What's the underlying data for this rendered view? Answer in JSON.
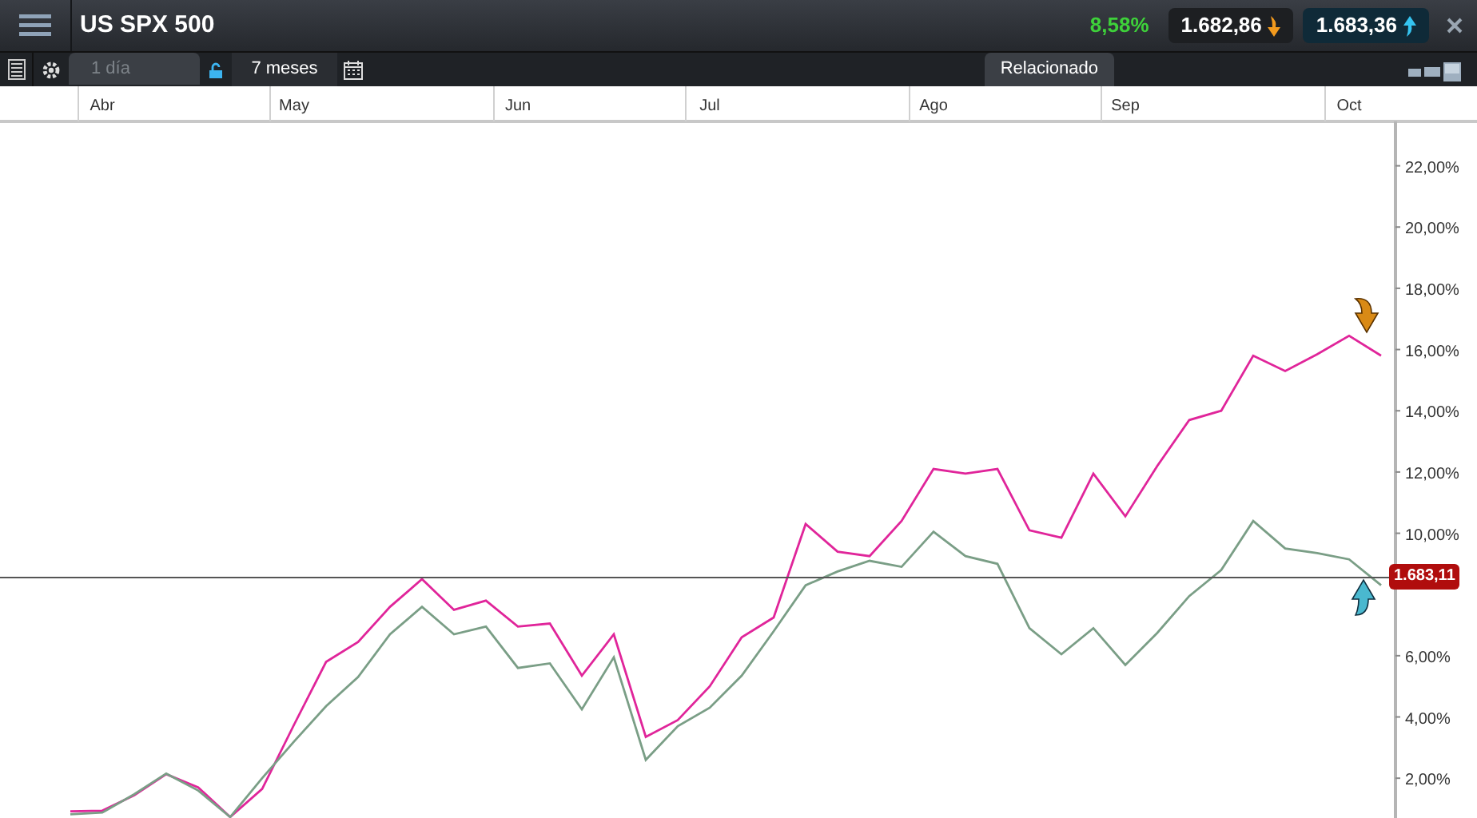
{
  "header": {
    "title": "US SPX 500",
    "change": "8,58%",
    "sell_price": "1.682,86",
    "buy_price": "1.683,36"
  },
  "toolbar": {
    "interval_placeholder": "1 día",
    "range": "7 meses",
    "related_tab": "Relacionado"
  },
  "chart": {
    "price_label": "1.683,11",
    "chart_data": {
      "type": "line",
      "categories": [
        null,
        "Abr",
        null,
        null,
        null,
        null,
        null,
        "May",
        null,
        null,
        null,
        null,
        null,
        null,
        "Jun",
        null,
        null,
        null,
        null,
        null,
        "Jul",
        null,
        null,
        null,
        null,
        null,
        null,
        "Ago",
        null,
        null,
        null,
        null,
        null,
        "Sep",
        null,
        null,
        null,
        null,
        null,
        null,
        "Oct",
        null
      ],
      "ylim": [
        0.7,
        23.45
      ],
      "yticks": [
        {
          "value": 2,
          "label": "2,00%"
        },
        {
          "value": 4,
          "label": "4,00%"
        },
        {
          "value": 6,
          "label": "6,00%"
        },
        {
          "value": 10,
          "label": "10,00%"
        },
        {
          "value": 12,
          "label": "12,00%"
        },
        {
          "value": 14,
          "label": "14,00%"
        },
        {
          "value": 16,
          "label": "16,00%"
        },
        {
          "value": 18,
          "label": "18,00%"
        },
        {
          "value": 20,
          "label": "20,00%"
        },
        {
          "value": 22,
          "label": "22,00%"
        }
      ],
      "series": [
        {
          "color": "#e0259a",
          "values": [
            0.92,
            0.94,
            1.44,
            2.13,
            1.7,
            0.73,
            1.65,
            3.75,
            5.8,
            6.45,
            7.6,
            8.5,
            7.5,
            7.8,
            6.95,
            7.05,
            5.35,
            6.7,
            3.35,
            3.9,
            5.0,
            6.6,
            7.25,
            10.3,
            9.4,
            9.25,
            10.4,
            12.1,
            11.95,
            12.1,
            10.1,
            9.85,
            11.95,
            10.55,
            12.2,
            13.7,
            14.0,
            15.8,
            15.3,
            15.85,
            16.45,
            15.8
          ]
        },
        {
          "color": "#7a9e86",
          "values": [
            0.82,
            0.88,
            1.48,
            2.15,
            1.6,
            0.73,
            2.0,
            3.2,
            4.35,
            5.3,
            6.7,
            7.6,
            6.7,
            6.95,
            5.6,
            5.75,
            4.25,
            5.95,
            2.6,
            3.7,
            4.3,
            5.35,
            6.8,
            8.3,
            8.75,
            9.1,
            8.9,
            10.05,
            9.25,
            9.0,
            6.9,
            6.05,
            6.9,
            5.7,
            6.75,
            7.95,
            8.8,
            10.4,
            9.5,
            9.35,
            9.15,
            8.3
          ]
        }
      ]
    }
  }
}
